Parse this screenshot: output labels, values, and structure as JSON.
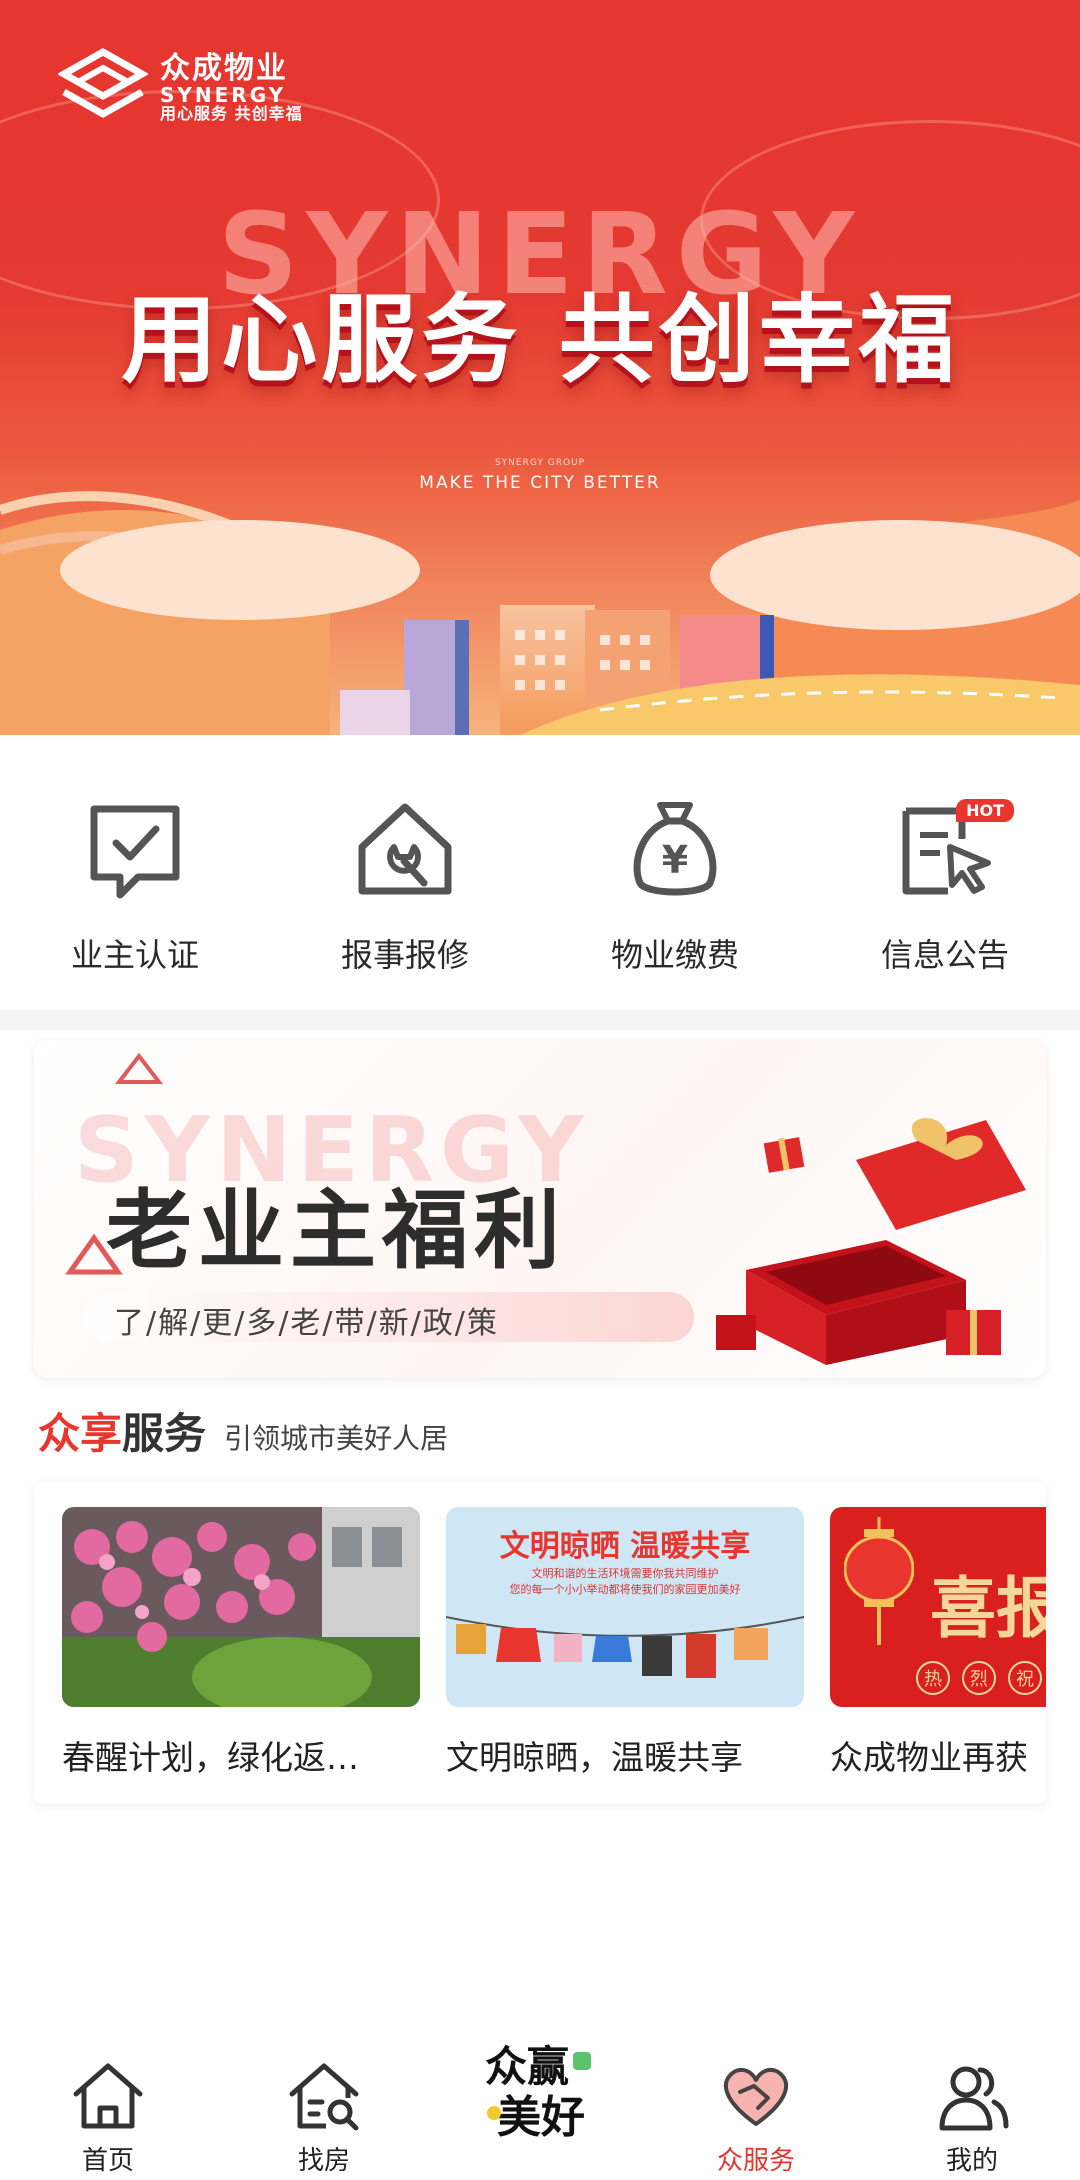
{
  "brand": {
    "name_cn": "众成物业",
    "name_en": "SYNERGY",
    "slogan": "用心服务 共创幸福"
  },
  "hero": {
    "bg_word": "SYNERGY",
    "headline": "用心服务 共创幸福",
    "small_text": "SYNERGY GROUP",
    "tagline": "MAKE THE CITY BETTER"
  },
  "quick_menu": [
    {
      "label": "业主认证",
      "icon": "chat-check-icon"
    },
    {
      "label": "报事报修",
      "icon": "house-wrench-icon"
    },
    {
      "label": "物业缴费",
      "icon": "money-bag-icon"
    },
    {
      "label": "信息公告",
      "icon": "notice-cursor-icon",
      "badge": "HOT"
    }
  ],
  "promo": {
    "bg_word": "SYNERGY",
    "title": "老业主福利",
    "subtitle": "了/解/更/多/老/带/新/政/策"
  },
  "section": {
    "title_red": "众享",
    "title_dark": "服务",
    "subtitle": "引领城市美好人居"
  },
  "cards": [
    {
      "title": "春醒计划，绿化返…"
    },
    {
      "title": "文明晾晒，温暖共享",
      "image_heading": "文明晾晒 温暖共享",
      "image_line1": "文明和谐的生活环境需要你我共同维护",
      "image_line2": "您的每一个小小举动都将使我们的家园更加美好"
    },
    {
      "title": "众成物业再获",
      "image_big": "喜报",
      "image_badges": [
        "热",
        "烈",
        "祝"
      ]
    }
  ],
  "tabbar": [
    {
      "label": "首页",
      "icon": "home-icon"
    },
    {
      "label": "找房",
      "icon": "house-search-icon"
    },
    {
      "label": "",
      "icon": "zhongying-meihao-logo",
      "logo_text_1": "众赢",
      "logo_text_2": "美好"
    },
    {
      "label": "众服务",
      "icon": "heart-handshake-icon",
      "active": true
    },
    {
      "label": "我的",
      "icon": "users-icon"
    }
  ],
  "colors": {
    "primary_red": "#e8352d",
    "text_dark": "#222222",
    "page_bg": "#ffffff"
  }
}
